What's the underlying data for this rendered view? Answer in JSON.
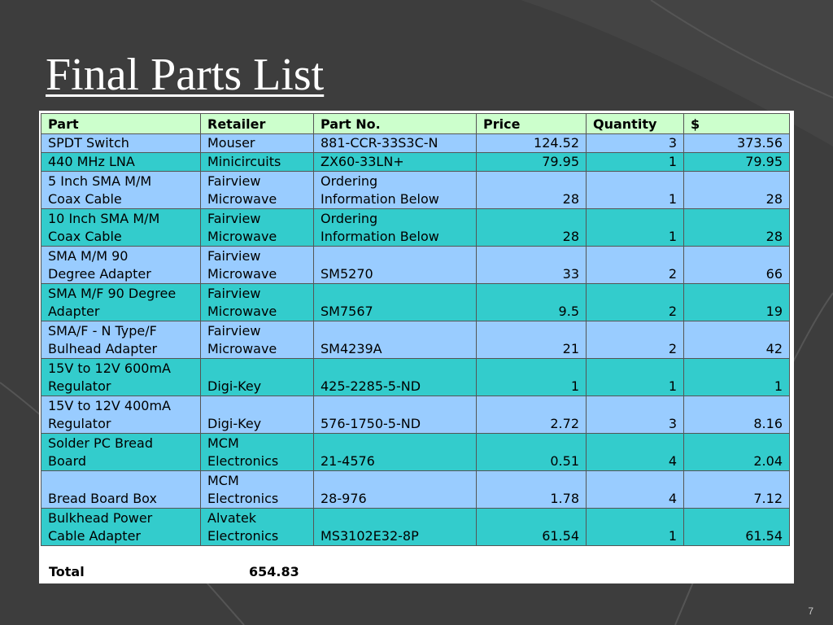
{
  "slide": {
    "title": "Final Parts List",
    "page_number": "7"
  },
  "table": {
    "headers": [
      "Part",
      "Retailer",
      "Part No.",
      "Price",
      "Quantity",
      "$"
    ],
    "rows": [
      {
        "part": [
          "SPDT Switch"
        ],
        "retailer": [
          "Mouser"
        ],
        "part_no": [
          "881-CCR-33S3C-N"
        ],
        "price": "124.52",
        "qty": "3",
        "total": "373.56"
      },
      {
        "part": [
          "440 MHz LNA"
        ],
        "retailer": [
          "Minicircuits"
        ],
        "part_no": [
          "ZX60-33LN+"
        ],
        "price": "79.95",
        "qty": "1",
        "total": "79.95"
      },
      {
        "part": [
          "5 Inch SMA M/M",
          "Coax Cable"
        ],
        "retailer": [
          "Fairview",
          "Microwave"
        ],
        "part_no": [
          "Ordering",
          "Information Below"
        ],
        "price": "28",
        "qty": "1",
        "total": "28"
      },
      {
        "part": [
          "10 Inch SMA M/M",
          "Coax Cable"
        ],
        "retailer": [
          "Fairview",
          "Microwave"
        ],
        "part_no": [
          "Ordering",
          "Information Below"
        ],
        "price": "28",
        "qty": "1",
        "total": "28"
      },
      {
        "part": [
          "SMA M/M 90",
          "Degree Adapter"
        ],
        "retailer": [
          "Fairview",
          "Microwave"
        ],
        "part_no": [
          "SM5270"
        ],
        "price": "33",
        "qty": "2",
        "total": "66"
      },
      {
        "part": [
          "SMA M/F 90 Degree",
          "Adapter"
        ],
        "retailer": [
          "Fairview",
          "Microwave"
        ],
        "part_no": [
          "SM7567"
        ],
        "price": "9.5",
        "qty": "2",
        "total": "19"
      },
      {
        "part": [
          "SMA/F - N Type/F",
          "Bulhead Adapter"
        ],
        "retailer": [
          "Fairview",
          "Microwave"
        ],
        "part_no": [
          "SM4239A"
        ],
        "price": "21",
        "qty": "2",
        "total": "42"
      },
      {
        "part": [
          "15V to 12V 600mA",
          "Regulator"
        ],
        "retailer": [
          "Digi-Key"
        ],
        "part_no": [
          "425-2285-5-ND"
        ],
        "price": "1",
        "qty": "1",
        "total": "1"
      },
      {
        "part": [
          "15V to 12V 400mA",
          "Regulator"
        ],
        "retailer": [
          "Digi-Key"
        ],
        "part_no": [
          "576-1750-5-ND"
        ],
        "price": "2.72",
        "qty": "3",
        "total": "8.16"
      },
      {
        "part": [
          "Solder PC Bread",
          "Board"
        ],
        "retailer": [
          "MCM",
          "Electronics"
        ],
        "part_no": [
          "21-4576"
        ],
        "price": "0.51",
        "qty": "4",
        "total": "2.04"
      },
      {
        "part": [
          "Bread Board Box"
        ],
        "retailer": [
          "MCM",
          "Electronics"
        ],
        "part_no": [
          "28-976"
        ],
        "price": "1.78",
        "qty": "4",
        "total": "7.12"
      },
      {
        "part": [
          "Bulkhead Power",
          "Cable Adapter"
        ],
        "retailer": [
          "Alvatek",
          "Electronics"
        ],
        "part_no": [
          "MS3102E32-8P"
        ],
        "price": "61.54",
        "qty": "1",
        "total": "61.54"
      }
    ],
    "total_label": "Total",
    "total_value": "654.83"
  },
  "colors": {
    "background": "#3d3d3d",
    "header": "#ccffcc",
    "row_blue": "#99ccff",
    "row_teal": "#33cccc"
  }
}
